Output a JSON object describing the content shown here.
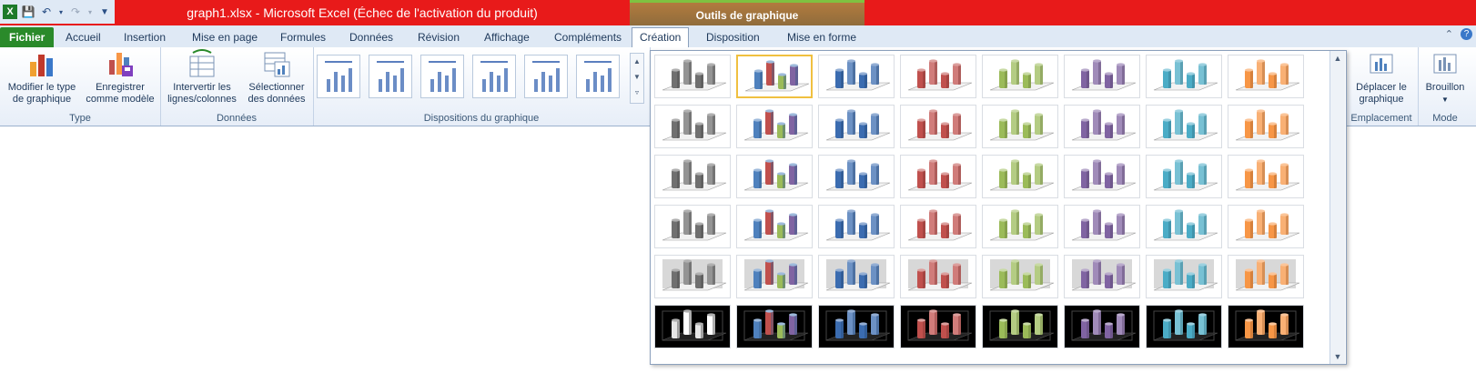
{
  "title_bar": {
    "title": "graph1.xlsx  -  Microsoft Excel (Échec de l'activation du produit)",
    "context_tab": "Outils de graphique",
    "qat": [
      {
        "icon": "excel-logo-icon"
      },
      {
        "icon": "save-icon"
      },
      {
        "icon": "undo-icon"
      },
      {
        "icon": "redo-icon"
      },
      {
        "icon": "customize-qat-icon"
      }
    ]
  },
  "tabs": [
    {
      "label": "Fichier",
      "kind": "file"
    },
    {
      "label": "Accueil"
    },
    {
      "label": "Insertion"
    },
    {
      "label": "Mise en page"
    },
    {
      "label": "Formules"
    },
    {
      "label": "Données"
    },
    {
      "label": "Révision"
    },
    {
      "label": "Affichage"
    },
    {
      "label": "Compléments"
    },
    {
      "label": "Création",
      "kind": "active"
    },
    {
      "label": "Disposition"
    },
    {
      "label": "Mise en forme"
    }
  ],
  "ribbon": {
    "groups": {
      "type": {
        "label": "Type",
        "change_type": "Modifier le type\nde graphique",
        "save_template": "Enregistrer\ncomme modèle"
      },
      "data": {
        "label": "Données",
        "switch": "Intervertir les\nlignes/colonnes",
        "select": "Sélectionner\ndes données"
      },
      "layouts": {
        "label": "Dispositions du graphique"
      },
      "location": {
        "label": "Emplacement",
        "move": "Déplacer le\ngraphique"
      },
      "mode": {
        "label": "Mode",
        "draft": "Brouillon"
      }
    }
  },
  "gallery": {
    "palettes": [
      "#707070",
      "#4f81bd",
      "#3b6cb0",
      "#c0504d",
      "#9bbb59",
      "#8064a2",
      "#4bacc6",
      "#f79646"
    ],
    "multi_colors": [
      "#4f81bd",
      "#c0504d",
      "#9bbb59",
      "#8064a2"
    ],
    "rows": [
      "flat",
      "light",
      "medium",
      "intense",
      "shaded",
      "dark"
    ],
    "selected": {
      "row": 0,
      "col": 1
    },
    "colors": {
      "dark_bg": "#000000",
      "shaded_bg": "#d8d8d8"
    }
  }
}
